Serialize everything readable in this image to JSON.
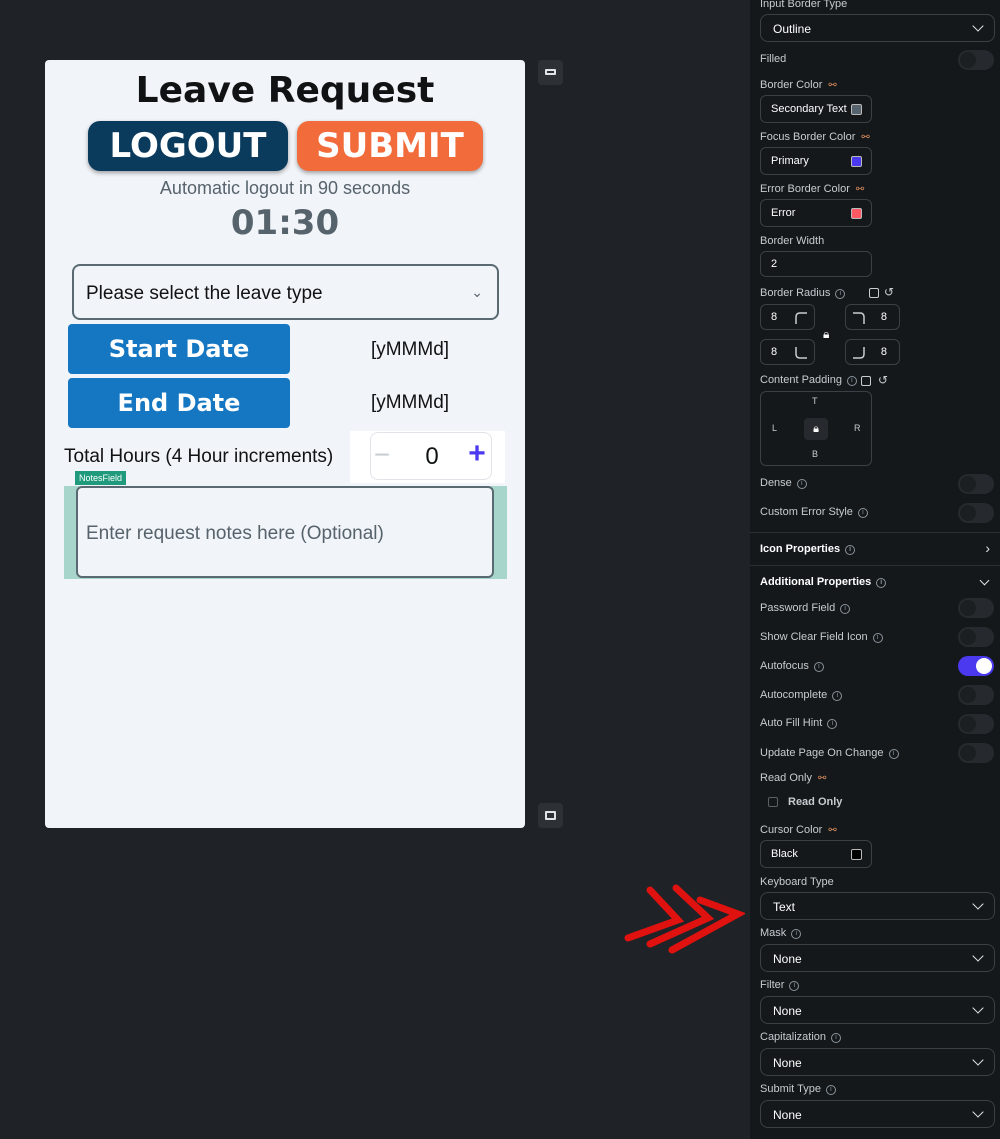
{
  "phone": {
    "title": "Leave Request",
    "logout_label": "LOGOUT",
    "submit_label": "SUBMIT",
    "logout_note": "Automatic logout in 90 seconds",
    "countdown": "01:30",
    "leave_select_placeholder": "Please select the leave type",
    "start_date_label": "Start Date",
    "end_date_label": "End Date",
    "start_date_format": "[yMMMd]",
    "end_date_format": "[yMMMd]",
    "hours_label": "Total Hours (4 Hour increments)",
    "stepper_minus": "−",
    "stepper_value": "0",
    "stepper_plus": "+",
    "notes_tag": "NotesField",
    "notes_placeholder": "Enter request notes here (Optional)"
  },
  "panel": {
    "input_border_type_label": "Input Border Type",
    "input_border_type_value": "Outline",
    "filled_label": "Filled",
    "border_color_label": "Border Color",
    "border_color_value": "Secondary Text",
    "focus_border_color_label": "Focus Border Color",
    "focus_border_color_value": "Primary",
    "error_border_color_label": "Error Border Color",
    "error_border_color_value": "Error",
    "border_width_label": "Border Width",
    "border_width_value": "2",
    "border_radius_label": "Border Radius",
    "radius_tl": "8",
    "radius_tr": "8",
    "radius_bl": "8",
    "radius_br": "8",
    "content_padding_label": "Content Padding",
    "pad_t": "T",
    "pad_l": "L",
    "pad_r": "R",
    "pad_b": "B",
    "dense_label": "Dense",
    "custom_error_style_label": "Custom Error Style",
    "icon_properties_label": "Icon Properties",
    "additional_properties_label": "Additional Properties",
    "password_field_label": "Password Field",
    "show_clear_field_icon_label": "Show Clear Field Icon",
    "autofocus_label": "Autofocus",
    "autocomplete_label": "Autocomplete",
    "auto_fill_hint_label": "Auto Fill Hint",
    "update_page_on_change_label": "Update Page On Change",
    "read_only_label": "Read Only",
    "read_only_checkbox_label": "Read Only",
    "cursor_color_label": "Cursor Color",
    "cursor_color_value": "Black",
    "keyboard_type_label": "Keyboard Type",
    "keyboard_type_value": "Text",
    "mask_label": "Mask",
    "mask_value": "None",
    "filter_label": "Filter",
    "filter_value": "None",
    "capitalization_label": "Capitalization",
    "capitalization_value": "None",
    "submit_type_label": "Submit Type",
    "submit_type_value": "None"
  },
  "colors": {
    "secondary_text": "#57636c",
    "primary": "#4b39ef",
    "error": "#ff5963",
    "black": "#000000",
    "logout_bg": "#0a3a5c",
    "submit_bg": "#f26b3a",
    "date_btn_bg": "#1577c2",
    "arrow": "#e0120f"
  },
  "toggles": {
    "filled": false,
    "dense": false,
    "custom_error_style": false,
    "password_field": false,
    "show_clear_field_icon": false,
    "autofocus": true,
    "autocomplete": false,
    "auto_fill_hint": false,
    "update_page_on_change": false,
    "read_only": false
  }
}
